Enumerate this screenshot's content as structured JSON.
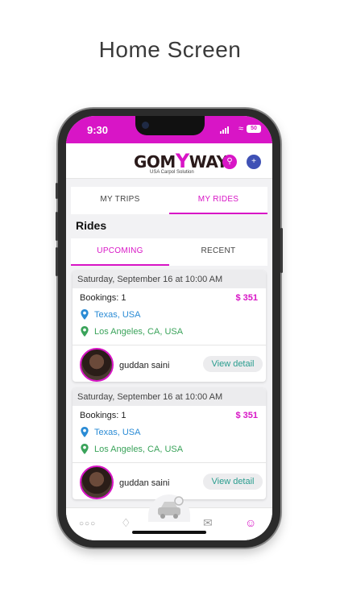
{
  "headline": "Home Screen",
  "status": {
    "time": "9:30",
    "battery": "50"
  },
  "app": {
    "logo_left": "GOM",
    "logo_mid": "Y",
    "logo_right": "WAY",
    "tagline": "USA Carpol Solution"
  },
  "top_tabs": [
    {
      "label": "MY TRIPS",
      "active": false
    },
    {
      "label": "MY RIDES",
      "active": true
    }
  ],
  "section_title": "Rides",
  "sub_tabs": [
    {
      "label": "UPCOMING",
      "active": true
    },
    {
      "label": "RECENT",
      "active": false
    }
  ],
  "rides": [
    {
      "date": "Saturday, September 16 at 10:00 AM",
      "bookings": "Bookings: 1",
      "price": "$ 351",
      "from": "Texas, USA",
      "to": "Los Angeles, CA, USA",
      "user": "guddan saini",
      "action": "View detail"
    },
    {
      "date": "Saturday, September 16 at 10:00 AM",
      "bookings": "Bookings: 1",
      "price": "$ 351",
      "from": "Texas, USA",
      "to": "Los Angeles, CA, USA",
      "user": "guddan saini",
      "action": "View detail"
    }
  ],
  "bottom_nav": [
    "more-icon",
    "bell-icon",
    "car-icon",
    "mail-icon",
    "profile-icon"
  ],
  "colors": {
    "brand": "#d815c6",
    "link_blue": "#2a8bd5",
    "link_green": "#3aa35a",
    "action_teal": "#2a9d8f",
    "search_btn": "#d815c6",
    "add_btn": "#3f51b5"
  }
}
